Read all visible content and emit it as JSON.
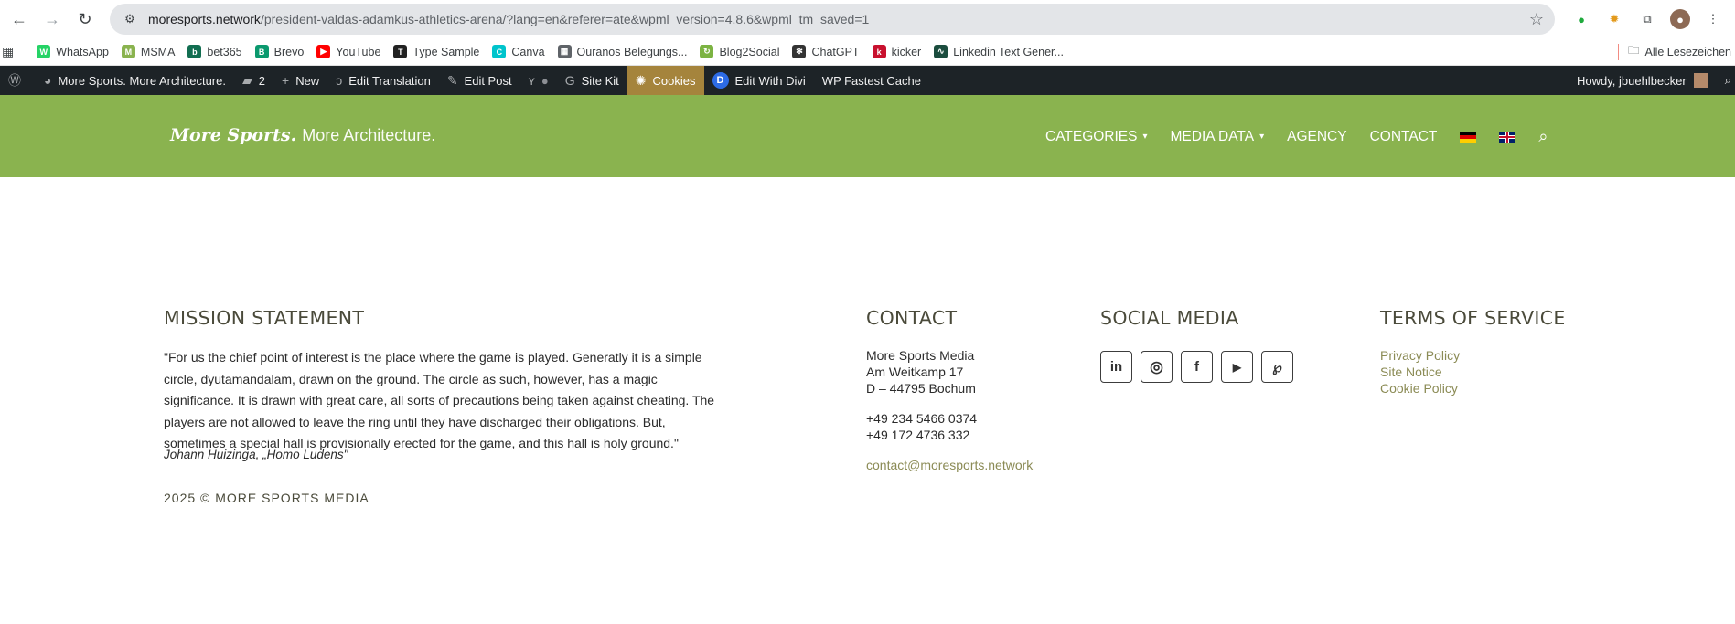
{
  "browser": {
    "url_domain": "moresports.network",
    "url_path": "/president-valdas-adamkus-athletics-arena/?lang=en&referer=ate&wpml_version=4.8.6&wpml_tm_saved=1"
  },
  "bookmarks": [
    {
      "label": "WhatsApp",
      "color": "#25d366",
      "glyph": "W"
    },
    {
      "label": "MSMA",
      "color": "#8ab34f",
      "glyph": "M"
    },
    {
      "label": "bet365",
      "color": "#126e51",
      "glyph": "b"
    },
    {
      "label": "Brevo",
      "color": "#0b996e",
      "glyph": "B"
    },
    {
      "label": "YouTube",
      "color": "#ff0000",
      "glyph": "▶"
    },
    {
      "label": "Type Sample",
      "color": "#222222",
      "glyph": "T"
    },
    {
      "label": "Canva",
      "color": "#00c4cc",
      "glyph": "C"
    },
    {
      "label": "Ouranos Belegungs...",
      "color": "#5f6368",
      "glyph": "▦"
    },
    {
      "label": "Blog2Social",
      "color": "#7cb342",
      "glyph": "↻"
    },
    {
      "label": "ChatGPT",
      "color": "#333333",
      "glyph": "✻"
    },
    {
      "label": "kicker",
      "color": "#c8102e",
      "glyph": "k"
    },
    {
      "label": "Linkedin Text Gener...",
      "color": "#1b4d3e",
      "glyph": "∿"
    }
  ],
  "bookmarks_right": "Alle Lesezeichen",
  "wpbar": {
    "site": "More Sports. More Architecture.",
    "comments": "2",
    "new": "New",
    "edit_translation": "Edit Translation",
    "edit_post": "Edit Post",
    "site_kit": "Site Kit",
    "cookies": "Cookies",
    "divi": "Edit With Divi",
    "fastest_cache": "WP Fastest Cache",
    "howdy": "Howdy, jbuehlbecker"
  },
  "header": {
    "logo_bold": "More Sports.",
    "logo_light": "More Architecture.",
    "nav": {
      "categories": "CATEGORIES",
      "media_data": "MEDIA DATA",
      "agency": "AGENCY",
      "contact": "CONTACT"
    }
  },
  "footer": {
    "mission_title": "MISSION STATEMENT",
    "mission_text": "\"For us the chief point of interest is the place where the game is played. Generatly it is a simple circle, dyutamandalam, drawn on the ground. The circle as such, however, has a magic significance. It is drawn with great care, all sorts of precautions being taken against cheating. The players are not allowed to leave the ring until they have discharged their obligations. But, sometimes a special hall is provisionally erected for the game, and this hall is holy ground.\"",
    "quote_author": "Johann Huizinga, „Homo Ludens\"",
    "copyright": "2025 © MORE SPORTS MEDIA",
    "contact_title": "CONTACT",
    "contact": {
      "company": "More Sports Media",
      "street": "Am Weitkamp 17",
      "city": "D – 44795 Bochum",
      "phone1": "+49 234 5466 0374",
      "phone2": "+49 172 4736 332",
      "email": "contact@moresports.network"
    },
    "social_title": "SOCIAL MEDIA",
    "terms_title": "TERMS OF SERVICE",
    "terms": {
      "privacy": "Privacy Policy",
      "notice": "Site Notice",
      "cookie": "Cookie Policy"
    }
  }
}
